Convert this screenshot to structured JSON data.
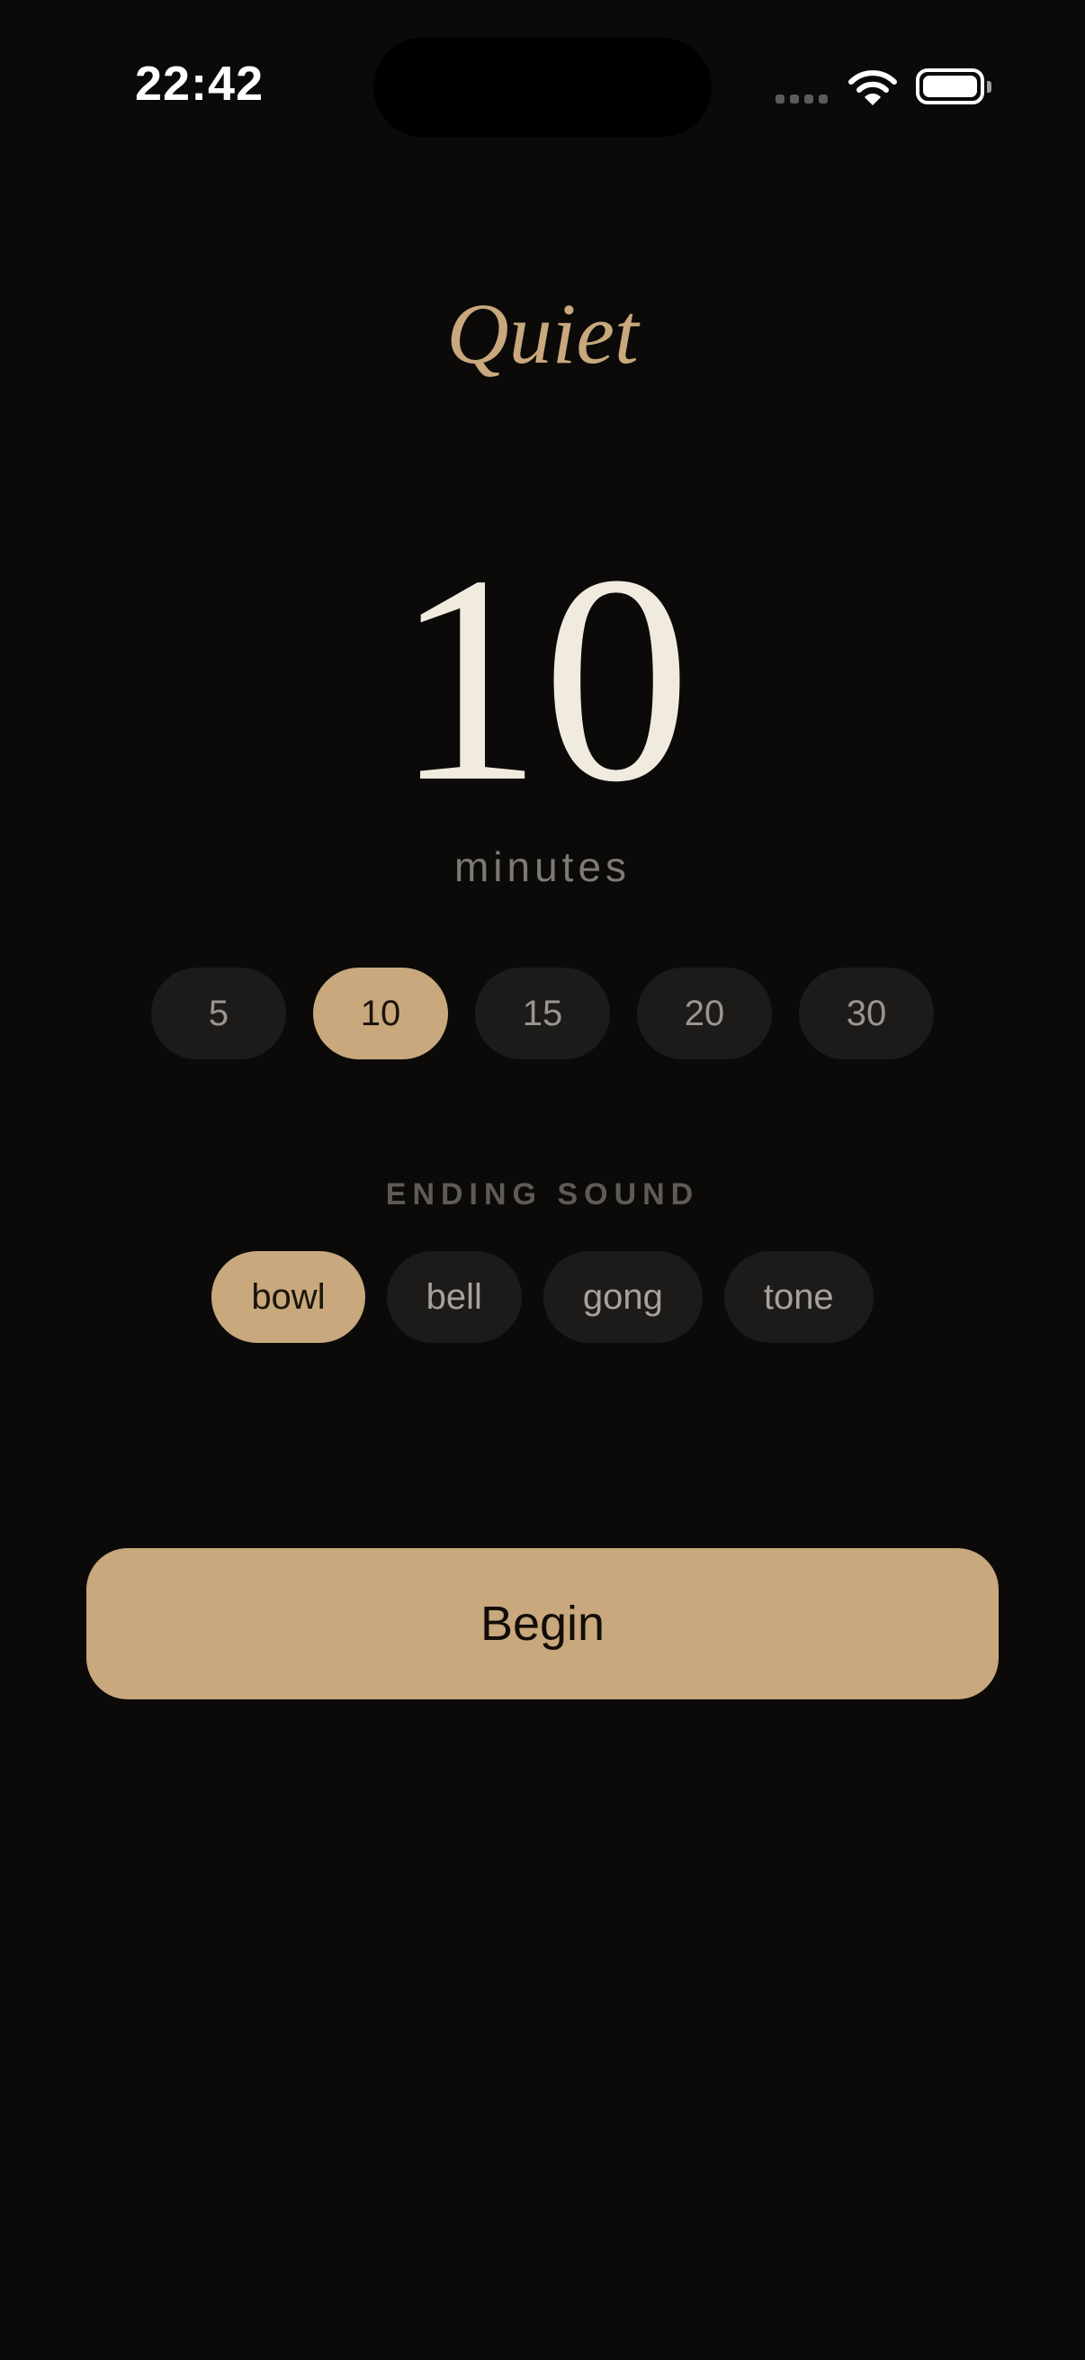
{
  "status_bar": {
    "time": "22:42"
  },
  "app": {
    "title": "Quiet"
  },
  "duration": {
    "value": "10",
    "unit": "minutes",
    "options": [
      "5",
      "10",
      "15",
      "20",
      "30"
    ],
    "selected": "10"
  },
  "ending_sound": {
    "label": "ENDING SOUND",
    "options": [
      "bowl",
      "bell",
      "gong",
      "tone"
    ],
    "selected": "bowl"
  },
  "begin_button": {
    "label": "Begin"
  },
  "colors": {
    "background": "#0b0a09",
    "accent": "#c8a87c",
    "pill": "#1c1b1a",
    "text_primary": "#f1ebdf",
    "text_muted": "#7d7a76"
  },
  "icons": [
    "cellular-signal-icon",
    "wifi-icon",
    "battery-icon"
  ]
}
